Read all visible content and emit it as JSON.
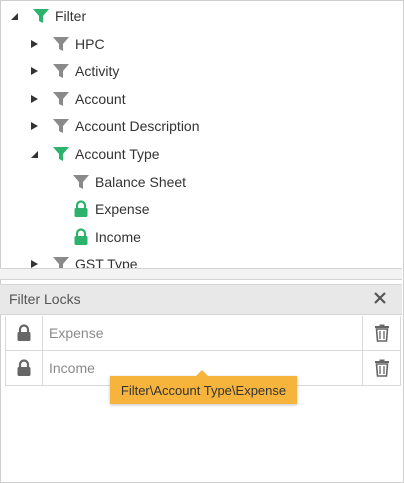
{
  "colors": {
    "green": "#2cb36b",
    "gray_filter": "#8a8a8a",
    "tooltip_bg": "#f6b43c"
  },
  "tree": {
    "root": {
      "label": "Filter",
      "icon": "filter-green-icon",
      "expanded": true
    },
    "children": [
      {
        "label": "HPC",
        "icon": "filter-gray-icon",
        "expanded": false
      },
      {
        "label": "Activity",
        "icon": "filter-gray-icon",
        "expanded": false
      },
      {
        "label": "Account",
        "icon": "filter-gray-icon",
        "expanded": false
      },
      {
        "label": "Account Description",
        "icon": "filter-gray-icon",
        "expanded": false
      },
      {
        "label": "Account Type",
        "icon": "filter-green-icon",
        "expanded": true,
        "children": [
          {
            "label": "Balance Sheet",
            "icon": "filter-gray-icon"
          },
          {
            "label": "Expense",
            "icon": "lock-green-icon"
          },
          {
            "label": "Income",
            "icon": "lock-green-icon"
          }
        ]
      },
      {
        "label": "GST Type",
        "icon": "filter-gray-icon",
        "expanded": false
      }
    ]
  },
  "filter_locks": {
    "title": "Filter Locks",
    "rows": [
      {
        "value": "Expense",
        "icon": "lock-icon",
        "delete_icon": "trash-icon"
      },
      {
        "value": "Income",
        "icon": "lock-icon",
        "delete_icon": "trash-icon"
      }
    ],
    "tooltip": "Filter\\Account Type\\Expense"
  }
}
